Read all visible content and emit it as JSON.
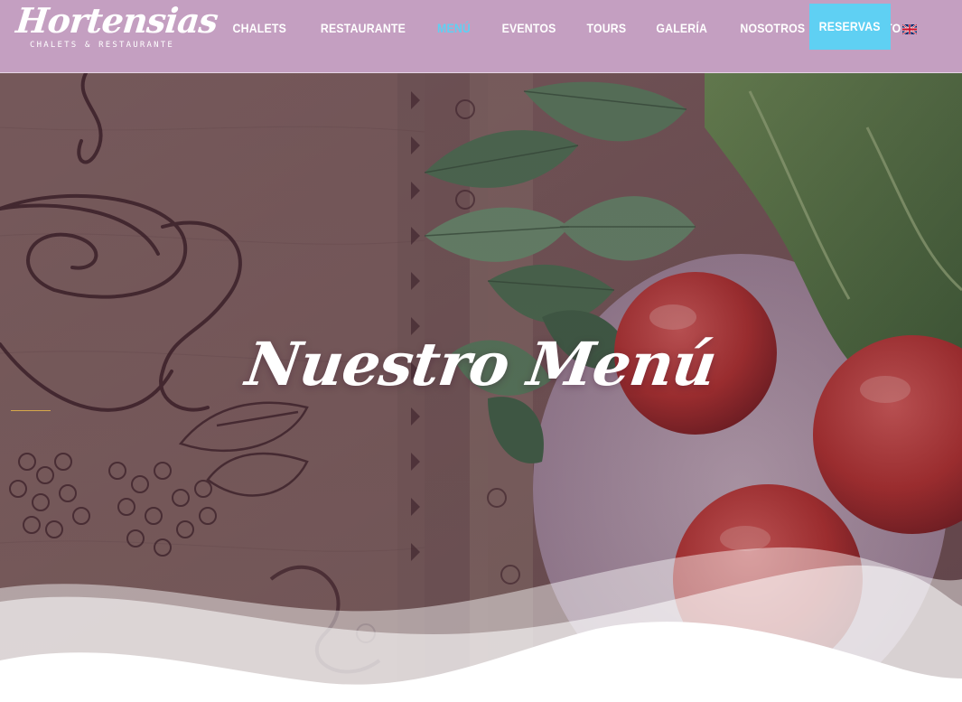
{
  "header": {
    "logo": {
      "wordmark": "Hortensias",
      "tagline": "CHALETS & RESTAURANTE"
    },
    "nav": [
      {
        "label": "CHALETS",
        "active": false
      },
      {
        "label": "RESTAURANTE",
        "active": false
      },
      {
        "label": "MENÚ",
        "active": true
      },
      {
        "label": "EVENTOS",
        "active": false
      },
      {
        "label": "TOURS",
        "active": false
      },
      {
        "label": "GALERÍA",
        "active": false
      },
      {
        "label": "NOSOTROS",
        "active": false
      },
      {
        "label": "CONTACTO",
        "active": false
      }
    ],
    "reserve_button": "RESERVAS",
    "language_icon": "uk-flag-icon"
  },
  "hero": {
    "title": "Nuestro Menú"
  },
  "colors": {
    "header_bg": "#c49fc1",
    "accent": "#5fd0f3",
    "text_light": "#ffffff",
    "accent_line": "#d7a94a"
  }
}
